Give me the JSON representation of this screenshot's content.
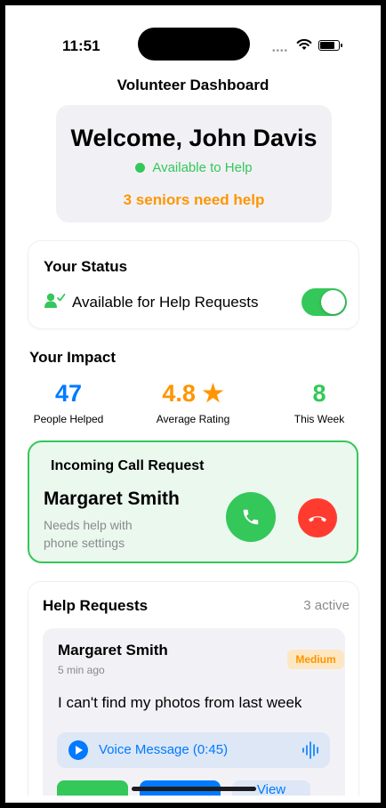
{
  "status_bar": {
    "time": "11:51",
    "signal": "••••"
  },
  "nav": {
    "title": "Volunteer Dashboard"
  },
  "welcome": {
    "title": "Welcome, John Davis",
    "availability": "Available to Help",
    "seniors_alert": "3 seniors need help"
  },
  "status": {
    "heading": "Your Status",
    "toggle_label": "Available for Help Requests",
    "toggle_on": true
  },
  "impact": {
    "heading": "Your Impact",
    "stats": [
      {
        "value": "47",
        "label": "People Helped"
      },
      {
        "value": "4.8",
        "label": "Average Rating",
        "icon": "star-icon"
      },
      {
        "value": "8",
        "label": "This Week"
      }
    ]
  },
  "incoming_call": {
    "heading": "Incoming Call Request",
    "caller": "Margaret Smith",
    "description": "Needs help with phone settings"
  },
  "help_requests": {
    "heading": "Help Requests",
    "count": "3 active",
    "items": [
      {
        "name": "Margaret Smith",
        "time": "5 min ago",
        "priority": "Medium",
        "message": "I can't find my photos from last week",
        "voice_label": "Voice Message (0:45)",
        "actions": [
          "",
          "",
          "View"
        ]
      }
    ]
  },
  "colors": {
    "green": "#34c759",
    "blue": "#007aff",
    "orange": "#ff9500",
    "red": "#ff3b30"
  }
}
